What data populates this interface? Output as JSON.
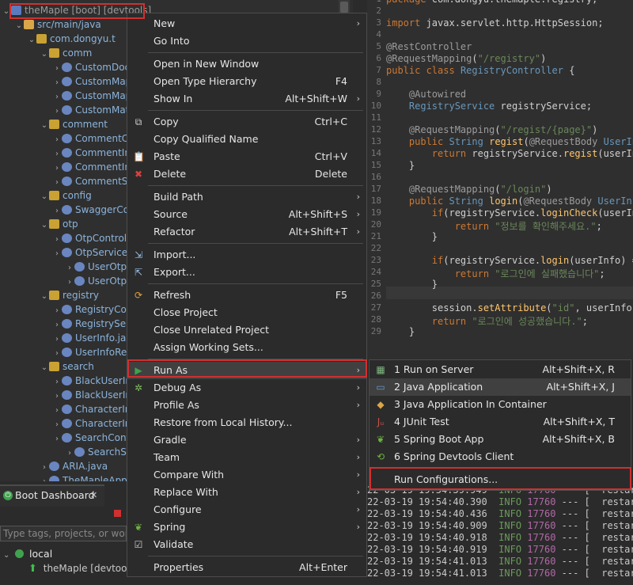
{
  "explorer": {
    "rows": [
      {
        "label": "theMaple [boot] [devtools]",
        "indent": 0,
        "icon": "project"
      },
      {
        "label": "src/main/java",
        "indent": 1,
        "icon": "src"
      },
      {
        "label": "com.dongyu.t",
        "indent": 2,
        "icon": "pkg"
      },
      {
        "label": "comm",
        "indent": 3,
        "icon": "pkg"
      },
      {
        "label": "CustomDoc",
        "indent": 4,
        "icon": "java"
      },
      {
        "label": "CustomMap",
        "indent": 4,
        "icon": "java"
      },
      {
        "label": "CustomMap",
        "indent": 4,
        "icon": "java"
      },
      {
        "label": "CustomMat",
        "indent": 4,
        "icon": "java"
      },
      {
        "label": "comment",
        "indent": 3,
        "icon": "pkg"
      },
      {
        "label": "CommentCo",
        "indent": 4,
        "icon": "java"
      },
      {
        "label": "CommentIn",
        "indent": 4,
        "icon": "java"
      },
      {
        "label": "CommentIn",
        "indent": 4,
        "icon": "java"
      },
      {
        "label": "CommentS",
        "indent": 4,
        "icon": "java"
      },
      {
        "label": "config",
        "indent": 3,
        "icon": "pkg"
      },
      {
        "label": "SwaggerCo",
        "indent": 4,
        "icon": "java"
      },
      {
        "label": "otp",
        "indent": 3,
        "icon": "pkg"
      },
      {
        "label": "OtpControl",
        "indent": 4,
        "icon": "java"
      },
      {
        "label": "OtpService.",
        "indent": 4,
        "icon": "java"
      },
      {
        "label": "UserOtp.j",
        "indent": 5,
        "icon": "java"
      },
      {
        "label": "UserOtpR",
        "indent": 5,
        "icon": "java"
      },
      {
        "label": "registry",
        "indent": 3,
        "icon": "pkg"
      },
      {
        "label": "RegistryCon",
        "indent": 4,
        "icon": "java"
      },
      {
        "label": "RegistryServ",
        "indent": 4,
        "icon": "java"
      },
      {
        "label": "UserInfo.jav",
        "indent": 4,
        "icon": "java"
      },
      {
        "label": "UserInfoRep",
        "indent": 4,
        "icon": "java"
      },
      {
        "label": "search",
        "indent": 3,
        "icon": "pkg"
      },
      {
        "label": "BlackUserIn",
        "indent": 4,
        "icon": "java"
      },
      {
        "label": "BlackUserIn",
        "indent": 4,
        "icon": "java"
      },
      {
        "label": "CharacterIn",
        "indent": 4,
        "icon": "java"
      },
      {
        "label": "CharacterIn",
        "indent": 4,
        "icon": "java"
      },
      {
        "label": "SearchCont",
        "indent": 4,
        "icon": "java"
      },
      {
        "label": "SearchSe",
        "indent": 5,
        "icon": "java"
      },
      {
        "label": "ARIA.java",
        "indent": 3,
        "icon": "java"
      },
      {
        "label": "TheMapleAppl",
        "indent": 3,
        "icon": "java"
      }
    ]
  },
  "editor": {
    "lines": [
      {
        "n": "1",
        "html": "<span class='kw'>package</span> com.dongyu.themaple.registry;"
      },
      {
        "n": "2",
        "html": ""
      },
      {
        "n": "3",
        "html": "<span class='kw'>import</span> javax.servlet.http.HttpSession;"
      },
      {
        "n": "4",
        "html": ""
      },
      {
        "n": "5",
        "html": "<span class='ann'>@RestController</span>"
      },
      {
        "n": "6",
        "html": "<span class='ann'>@RequestMapping</span>(<span class='str'>\"/registry\"</span>)"
      },
      {
        "n": "7",
        "html": "<span class='kw'>public class</span> <span class='typ'>RegistryController</span> {"
      },
      {
        "n": "8",
        "html": ""
      },
      {
        "n": "9",
        "html": "    <span class='ann'>@Autowired</span>"
      },
      {
        "n": "10",
        "html": "    <span class='typ'>RegistryService</span> registryService;"
      },
      {
        "n": "11",
        "html": ""
      },
      {
        "n": "12",
        "html": "    <span class='ann'>@RequestMapping</span>(<span class='str'>\"/regist/{page}\"</span>)"
      },
      {
        "n": "13",
        "html": "    <span class='kw'>public</span> <span class='typ'>String</span> <span class='fn'>regist</span>(<span class='ann'>@RequestBody</span> <span class='typ'>UserInf</span>"
      },
      {
        "n": "14",
        "html": "        <span class='kw'>return</span> registryService.<span class='fn'>regist</span>(userInf"
      },
      {
        "n": "15",
        "html": "    }"
      },
      {
        "n": "16",
        "html": ""
      },
      {
        "n": "17",
        "html": "    <span class='ann'>@RequestMapping</span>(<span class='str'>\"/login\"</span>)"
      },
      {
        "n": "18",
        "html": "    <span class='kw'>public</span> <span class='typ'>String</span> <span class='fn'>login</span>(<span class='ann'>@RequestBody</span> <span class='typ'>UserInfo</span>"
      },
      {
        "n": "19",
        "html": "        <span class='kw'>if</span>(registryService.<span class='fn'>loginCheck</span>(userInf"
      },
      {
        "n": "20",
        "html": "            <span class='kw'>return</span> <span class='str'>\"정보를 확인해주세요.\"</span>;"
      },
      {
        "n": "21",
        "html": "        }"
      },
      {
        "n": "22",
        "html": ""
      },
      {
        "n": "23",
        "html": "        <span class='kw'>if</span>(registryService.<span class='fn'>login</span>(userInfo) =="
      },
      {
        "n": "24",
        "html": "            <span class='kw'>return</span> <span class='str'>\"로그인에 실패했습니다\"</span>;"
      },
      {
        "n": "25",
        "html": "        }"
      },
      {
        "n": "26",
        "html": ""
      },
      {
        "n": "27",
        "html": "        session.<span class='fn'>setAttribute</span>(<span class='str'>\"id\"</span>, userInfo.g"
      },
      {
        "n": "28",
        "html": "        <span class='kw'>return</span> <span class='str'>\"로그인에 성공했습니다.\"</span>;"
      },
      {
        "n": "29",
        "html": "    }"
      }
    ]
  },
  "boot_dashboard": {
    "tab_label": "Boot Dashboard",
    "close": "✕",
    "filter_placeholder": "Type tags, projects, or working",
    "group_label": "local",
    "app_label": "theMaple [devtools]"
  },
  "console": {
    "lines": [
      {
        "t": "22-03-19 19:54:39.949",
        "lvl": "INFO",
        "pid": "17760",
        "rest": " --- [  restart"
      },
      {
        "t": "22-03-19 19:54:40.390",
        "lvl": "INFO",
        "pid": "17760",
        "rest": " --- [  restart"
      },
      {
        "t": "22-03-19 19:54:40.436",
        "lvl": "INFO",
        "pid": "17760",
        "rest": " --- [  restart"
      },
      {
        "t": "22-03-19 19:54:40.909",
        "lvl": "INFO",
        "pid": "17760",
        "rest": " --- [  restart"
      },
      {
        "t": "22-03-19 19:54:40.918",
        "lvl": "INFO",
        "pid": "17760",
        "rest": " --- [  restart"
      },
      {
        "t": "22-03-19 19:54:40.919",
        "lvl": "INFO",
        "pid": "17760",
        "rest": " --- [  restart"
      },
      {
        "t": "22-03-19 19:54:41.013",
        "lvl": "INFO",
        "pid": "17760",
        "rest": " --- [  restart"
      },
      {
        "t": "22-03-19 19:54:41.013",
        "lvl": "INFO",
        "pid": "17760",
        "rest": " --- [  restart"
      }
    ]
  },
  "context_menu": {
    "items": [
      {
        "label": "New",
        "accel": "",
        "sub": true,
        "icon": ""
      },
      {
        "label": "Go Into",
        "accel": "",
        "sub": false,
        "icon": ""
      },
      {
        "sep": true
      },
      {
        "label": "Open in New Window",
        "accel": "",
        "sub": false,
        "icon": ""
      },
      {
        "label": "Open Type Hierarchy",
        "accel": "F4",
        "sub": false,
        "icon": ""
      },
      {
        "label": "Show In",
        "accel": "Alt+Shift+W",
        "sub": true,
        "icon": ""
      },
      {
        "sep": true
      },
      {
        "label": "Copy",
        "accel": "Ctrl+C",
        "sub": false,
        "icon": "copy"
      },
      {
        "label": "Copy Qualified Name",
        "accel": "",
        "sub": false,
        "icon": ""
      },
      {
        "label": "Paste",
        "accel": "Ctrl+V",
        "sub": false,
        "icon": "paste"
      },
      {
        "label": "Delete",
        "accel": "Delete",
        "sub": false,
        "icon": "delete"
      },
      {
        "sep": true
      },
      {
        "label": "Build Path",
        "accel": "",
        "sub": true,
        "icon": ""
      },
      {
        "label": "Source",
        "accel": "Alt+Shift+S",
        "sub": true,
        "icon": ""
      },
      {
        "label": "Refactor",
        "accel": "Alt+Shift+T",
        "sub": true,
        "icon": ""
      },
      {
        "sep": true
      },
      {
        "label": "Import...",
        "accel": "",
        "sub": false,
        "icon": "import"
      },
      {
        "label": "Export...",
        "accel": "",
        "sub": false,
        "icon": "export"
      },
      {
        "sep": true
      },
      {
        "label": "Refresh",
        "accel": "F5",
        "sub": false,
        "icon": "refresh"
      },
      {
        "label": "Close Project",
        "accel": "",
        "sub": false,
        "icon": ""
      },
      {
        "label": "Close Unrelated Project",
        "accel": "",
        "sub": false,
        "icon": ""
      },
      {
        "label": "Assign Working Sets...",
        "accel": "",
        "sub": false,
        "icon": ""
      },
      {
        "sep": true
      },
      {
        "label": "Run As",
        "accel": "",
        "sub": true,
        "icon": "run",
        "highlight": true
      },
      {
        "label": "Debug As",
        "accel": "",
        "sub": true,
        "icon": "debug"
      },
      {
        "label": "Profile As",
        "accel": "",
        "sub": true,
        "icon": ""
      },
      {
        "label": "Restore from Local History...",
        "accel": "",
        "sub": false,
        "icon": ""
      },
      {
        "label": "Gradle",
        "accel": "",
        "sub": true,
        "icon": ""
      },
      {
        "label": "Team",
        "accel": "",
        "sub": true,
        "icon": ""
      },
      {
        "label": "Compare With",
        "accel": "",
        "sub": true,
        "icon": ""
      },
      {
        "label": "Replace With",
        "accel": "",
        "sub": true,
        "icon": ""
      },
      {
        "label": "Configure",
        "accel": "",
        "sub": true,
        "icon": ""
      },
      {
        "label": "Spring",
        "accel": "",
        "sub": true,
        "icon": "spring"
      },
      {
        "label": "Validate",
        "accel": "",
        "sub": false,
        "icon": "check"
      },
      {
        "sep": true
      },
      {
        "label": "Properties",
        "accel": "Alt+Enter",
        "sub": false,
        "icon": ""
      }
    ]
  },
  "run_as_menu": {
    "items": [
      {
        "label": "1 Run on Server",
        "accel": "Alt+Shift+X, R",
        "icon": "server"
      },
      {
        "label": "2 Java Application",
        "accel": "Alt+Shift+X, J",
        "icon": "java-app",
        "highlight": true
      },
      {
        "label": "3 Java Application In Container",
        "accel": "",
        "icon": "container"
      },
      {
        "label": "4 JUnit Test",
        "accel": "Alt+Shift+X, T",
        "icon": "junit"
      },
      {
        "label": "5 Spring Boot App",
        "accel": "Alt+Shift+X, B",
        "icon": "spring-boot"
      },
      {
        "label": "6 Spring Devtools Client",
        "accel": "",
        "icon": "devtools"
      },
      {
        "sep": true
      },
      {
        "label": "Run Configurations...",
        "accel": "",
        "icon": ""
      }
    ]
  },
  "colors": {
    "highlight_border": "#d03030",
    "menu_bg": "#2b2b2b"
  }
}
